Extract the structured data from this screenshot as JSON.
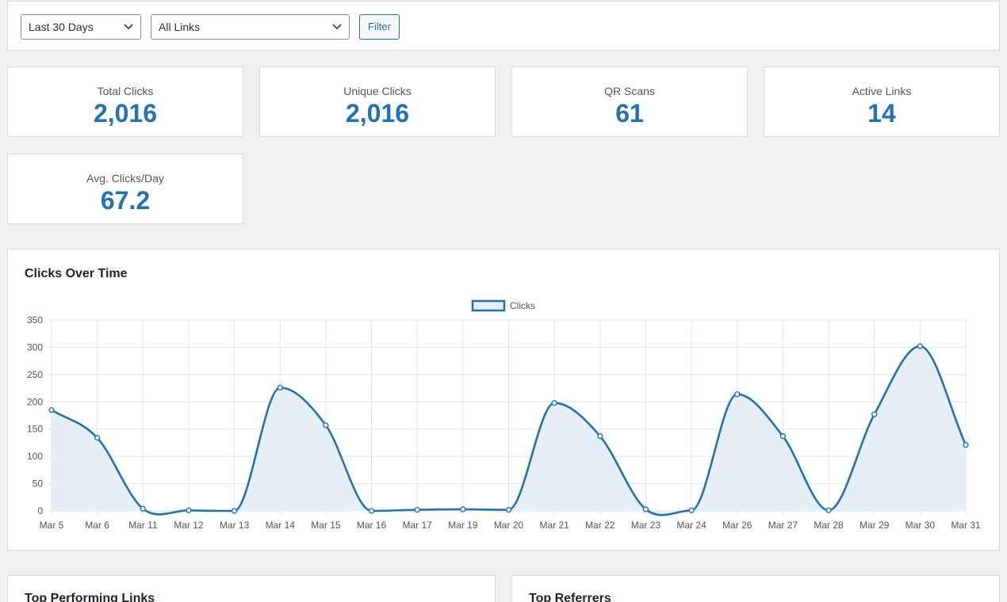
{
  "filters": {
    "range_label": "Last 30 Days",
    "links_label": "All Links",
    "filter_button": "Filter"
  },
  "stats": [
    {
      "label": "Total Clicks",
      "value": "2,016"
    },
    {
      "label": "Unique Clicks",
      "value": "2,016"
    },
    {
      "label": "QR Scans",
      "value": "61"
    },
    {
      "label": "Active Links",
      "value": "14"
    },
    {
      "label": "Avg. Clicks/Day",
      "value": "67.2"
    }
  ],
  "chart": {
    "title": "Clicks Over Time"
  },
  "sections": {
    "top_links_title": "Top Performing Links",
    "top_referrers_title": "Top Referrers"
  },
  "colors": {
    "accent": "#2271b1",
    "fill": "#e6eef6",
    "grid": "#e5e5e5"
  },
  "chart_data": {
    "type": "area",
    "title": "Clicks Over Time",
    "xlabel": "",
    "ylabel": "",
    "ylim": [
      0,
      350
    ],
    "yticks": [
      0,
      50,
      100,
      150,
      200,
      250,
      300,
      350
    ],
    "grid": true,
    "legend": "top-center",
    "categories": [
      "Mar 5",
      "Mar 6",
      "Mar 11",
      "Mar 12",
      "Mar 13",
      "Mar 14",
      "Mar 15",
      "Mar 16",
      "Mar 17",
      "Mar 19",
      "Mar 20",
      "Mar 21",
      "Mar 22",
      "Mar 23",
      "Mar 24",
      "Mar 26",
      "Mar 27",
      "Mar 28",
      "Mar 29",
      "Mar 30",
      "Mar 31"
    ],
    "series": [
      {
        "name": "Clicks",
        "values": [
          185,
          134,
          4,
          1,
          0,
          226,
          157,
          0,
          2,
          3,
          2,
          198,
          137,
          3,
          1,
          214,
          137,
          1,
          177,
          302,
          121
        ]
      }
    ]
  }
}
